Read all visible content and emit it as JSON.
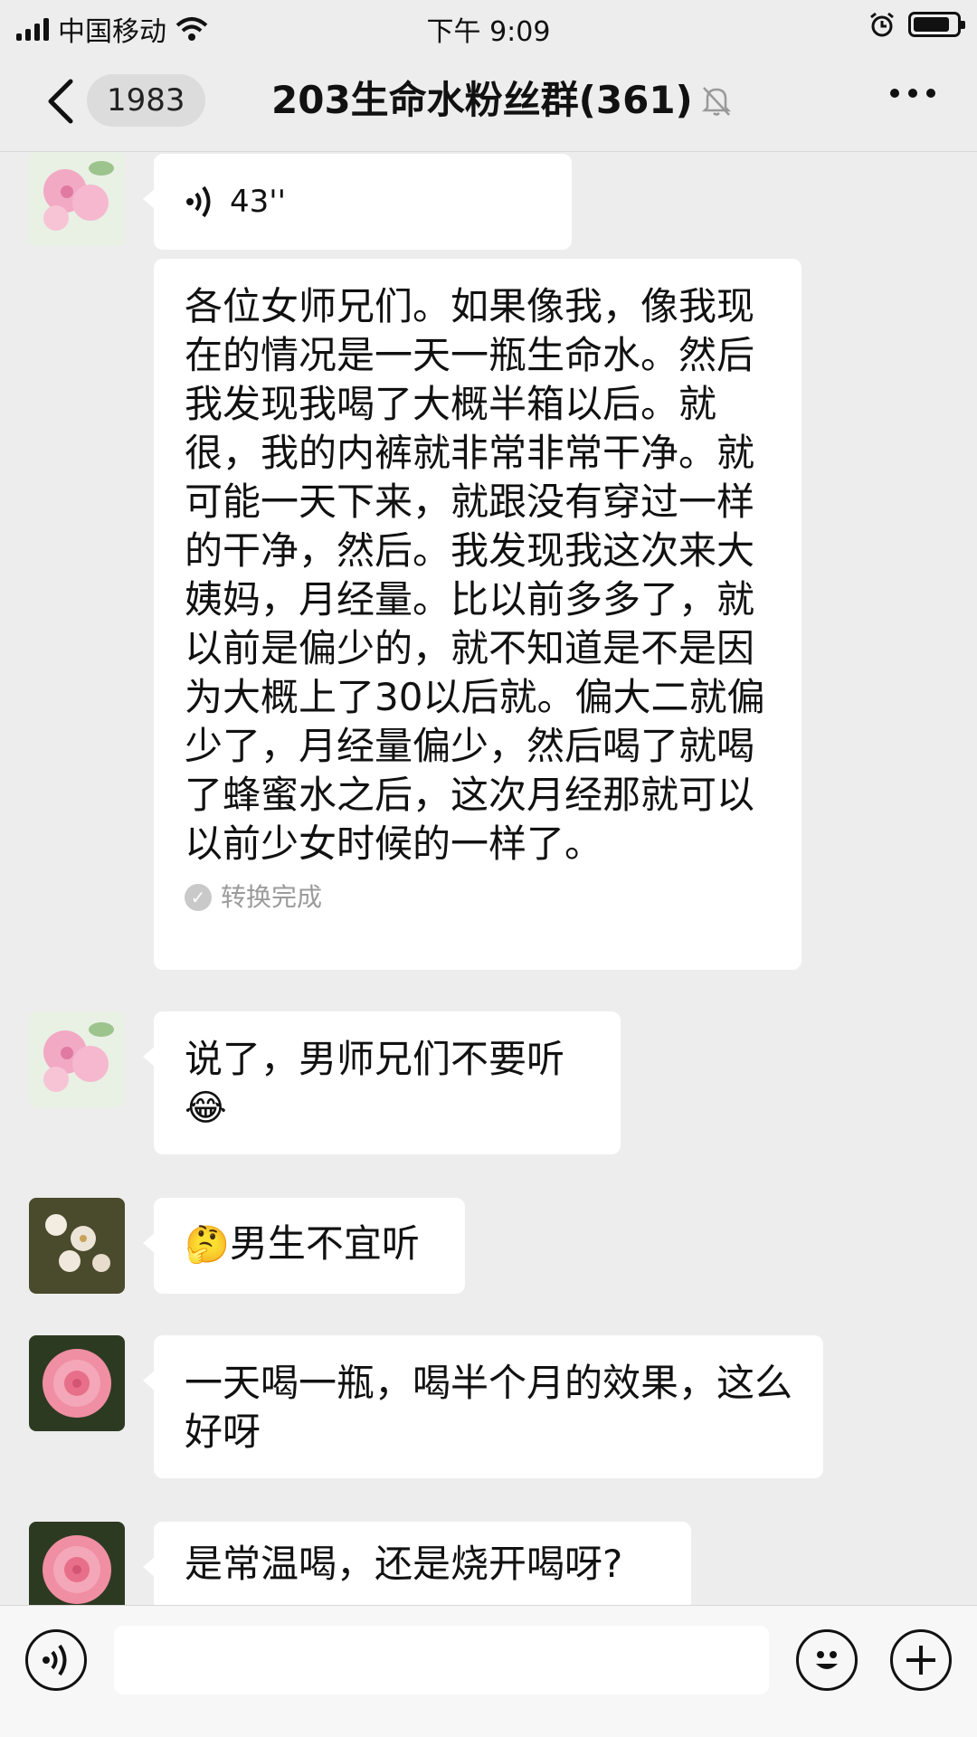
{
  "status_bar": {
    "carrier": "中国移动",
    "time": "下午 9:09",
    "battery_level": 0.85
  },
  "nav": {
    "back_count": "1983",
    "title": "203生命水粉丝群(361)"
  },
  "messages": [
    {
      "type": "voice",
      "duration": "43''"
    },
    {
      "type": "transcript",
      "text": "各位女师兄们。如果像我，像我现在的情况是一天一瓶生命水。然后我发现我喝了大概半箱以后。就很，我的内裤就非常非常干净。就可能一天下来，就跟没有穿过一样的干净，然后。我发现我这次来大姨妈，月经量。比以前多多了，就以前是偏少的，就不知道是不是因为大概上了30以后就。偏大二就偏少了，月经量偏少，然后喝了就喝了蜂蜜水之后，这次月经那就可以以前少女时候的一样了。",
      "status": "转换完成"
    },
    {
      "type": "text",
      "text": "说了，男师兄们不要听",
      "emoji": "😂"
    },
    {
      "type": "text",
      "emoji_prefix": "🤔",
      "text": "男生不宜听"
    },
    {
      "type": "text",
      "text": "一天喝一瓶，喝半个月的效果，这么好呀"
    },
    {
      "type": "text",
      "text": "是常温喝，还是烧开喝呀?"
    }
  ],
  "icons": {
    "back": "chevron-left-icon",
    "bell_off": "bell-muted-icon",
    "more": "more-dots-icon",
    "voice": "voice-wave-icon",
    "emoji": "smiley-icon",
    "plus": "plus-icon"
  }
}
